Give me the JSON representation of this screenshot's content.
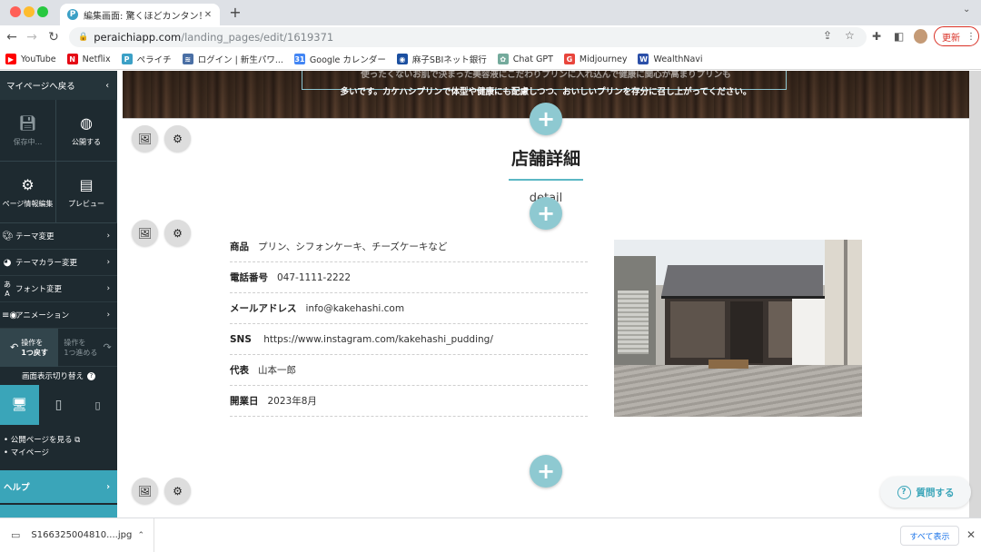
{
  "browser": {
    "tab_title": "編集画面: 驚くほどカンタン！無料",
    "tab_favicon": "P",
    "url_host": "peraichiapp.com",
    "url_path": "/landing_pages/edit/1619371",
    "update_label": "更新",
    "bookmarks": [
      {
        "label": "YouTube",
        "color": "#ff0000",
        "glyph": "▶"
      },
      {
        "label": "Netflix",
        "color": "#e50914",
        "glyph": "N"
      },
      {
        "label": "ペライチ",
        "color": "#3ba0c6",
        "glyph": "P"
      },
      {
        "label": "ログイン | 新生パワ...",
        "color": "#4a6fa5",
        "glyph": "≋"
      },
      {
        "label": "Google カレンダー",
        "color": "#4285f4",
        "glyph": "31"
      },
      {
        "label": "麻子SBIネット銀行",
        "color": "#1b4fa0",
        "glyph": "◉"
      },
      {
        "label": "Chat GPT",
        "color": "#74aa9c",
        "glyph": "✿"
      },
      {
        "label": "Midjourney",
        "color": "#e8453c",
        "glyph": "G"
      },
      {
        "label": "WealthNavi",
        "color": "#2b4fa8",
        "glyph": "W"
      }
    ]
  },
  "sidebar": {
    "back_label": "マイページへ戻る",
    "save_label": "保存中...",
    "publish_label": "公開する",
    "page_info_label": "ページ情報編集",
    "preview_label": "プレビュー",
    "menu": [
      {
        "label": "テーマ変更",
        "icon": "palette-icon"
      },
      {
        "label": "テーマカラー変更",
        "icon": "color-palette-icon"
      },
      {
        "label": "フォント変更",
        "icon": "font-icon"
      },
      {
        "label": "アニメーション",
        "icon": "animation-icon"
      }
    ],
    "undo_label_1": "操作を",
    "undo_label_2": "1つ戻す",
    "redo_label_1": "操作を",
    "redo_label_2": "1つ進める",
    "display_switch_label": "画面表示切り替え",
    "view_public_label": "公開ページを見る",
    "mypage_label": "マイページ",
    "help_label": "ヘルプ"
  },
  "hero": {
    "text_line1": "使ったくないお肌で決まった美容液にこだわりプリンに入れ込んで健康に関心が高まりプリンも",
    "text_line2": "多いです。カケハシプリンで体型や健康にも配慮しつつ、おいしいプリンを存分に召し上がってください。"
  },
  "section": {
    "title": "店舗詳細",
    "subtitle": "detail",
    "rows": [
      {
        "key": "商品",
        "value": "プリン、シフォンケーキ、チーズケーキなど"
      },
      {
        "key": "電話番号",
        "value": "047-1111-2222"
      },
      {
        "key": "メールアドレス",
        "value": "info@kakehashi.com"
      },
      {
        "key": "SNS",
        "value": " https://www.instagram.com/kakehashi_pudding/"
      },
      {
        "key": "代表",
        "value": "山本一郎"
      },
      {
        "key": "開業日",
        "value": "2023年8月"
      }
    ]
  },
  "help_float_label": "質問する",
  "download": {
    "filename": "S166325004810....jpg",
    "show_all_label": "すべて表示"
  }
}
